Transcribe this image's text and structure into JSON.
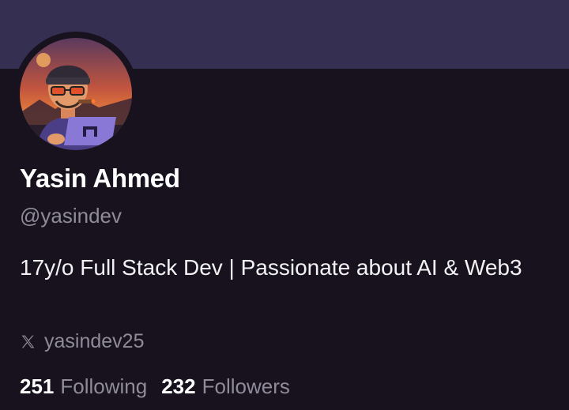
{
  "profile": {
    "display_name": "Yasin Ahmed",
    "handle": "@yasindev",
    "bio": "17y/o Full Stack Dev | Passionate about AI & Web3",
    "x_handle": "yasindev25",
    "x_icon": "x-logo-icon",
    "avatar_icon": "avatar-illustration"
  },
  "stats": {
    "following_count": "251",
    "following_label": "Following",
    "followers_count": "232",
    "followers_label": "Followers"
  },
  "colors": {
    "banner": "#352f52",
    "background": "#17121e",
    "muted_text": "#8f8b99",
    "text": "#ffffff"
  }
}
